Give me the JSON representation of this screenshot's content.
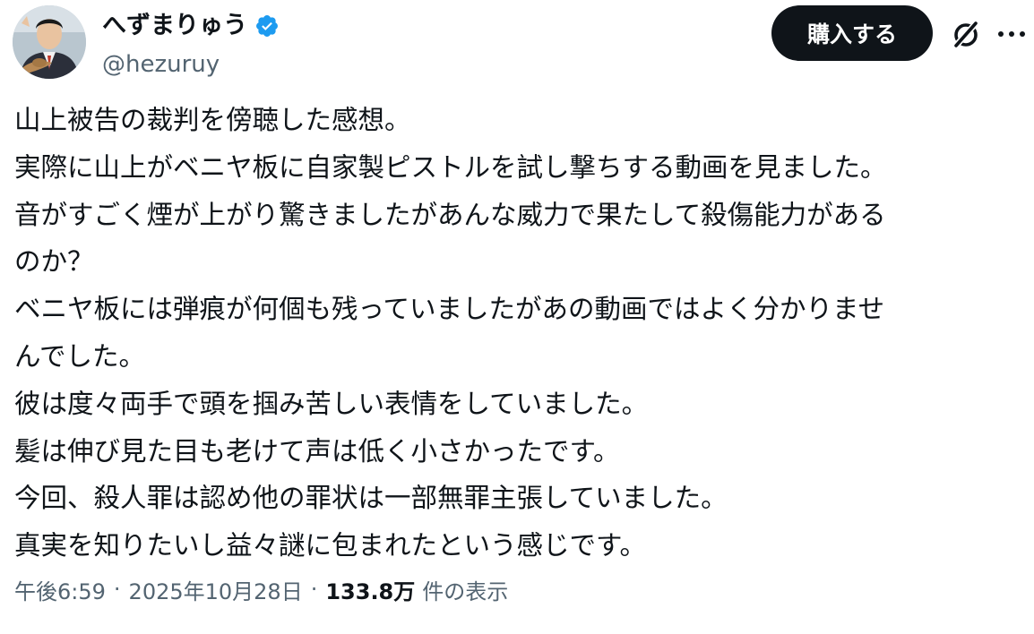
{
  "author": {
    "display_name": "へずまりゅう",
    "handle": "@hezuruy",
    "verified": true,
    "avatar_icon": "profile-photo",
    "verified_icon": "verified-badge-icon",
    "verified_color": "#1d9bf0"
  },
  "actions": {
    "buy_label": "購入する",
    "grok_icon": "grok-icon",
    "more_icon": "more-options-icon"
  },
  "tweet": {
    "lines": [
      "山上被告の裁判を傍聴した感想。",
      "実際に山上がベニヤ板に自家製ピストルを試し撃ちする動画を見ました。",
      "音がすごく煙が上がり驚きましたがあんな威力で果たして殺傷能力がある",
      "のか？",
      "ベニヤ板には弾痕が何個も残っていましたがあの動画ではよく分かりませ",
      "んでした。",
      "彼は度々両手で頭を掴み苦しい表情をしていました。",
      "髪は伸び見た目も老けて声は低く小さかったです。",
      "今回、殺人罪は認め他の罪状は一部無罪主張していました。",
      "真実を知りたいし益々謎に包まれたという感じです。"
    ]
  },
  "meta": {
    "time": "午後6:59",
    "separator": "·",
    "date": "2025年10月28日",
    "views_count": "133.8万",
    "views_label": "件の表示"
  },
  "colors": {
    "text_primary": "#0f1419",
    "text_secondary": "#536471",
    "button_bg": "#0f1419",
    "button_text": "#ffffff"
  }
}
